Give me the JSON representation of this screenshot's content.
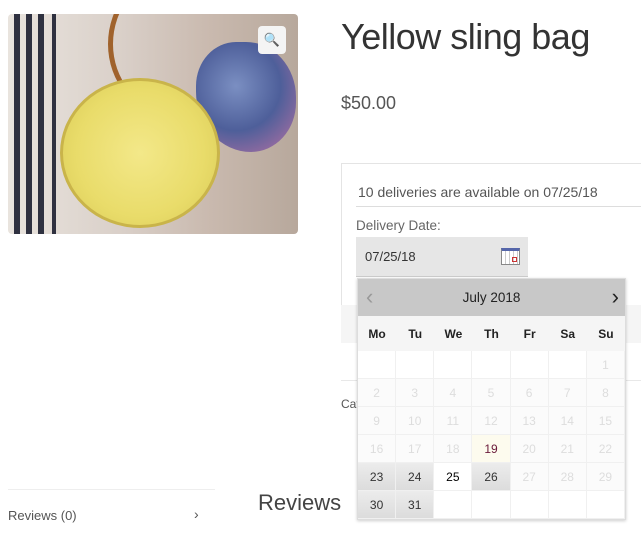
{
  "product": {
    "title": "Yellow sling bag",
    "price": "$50.00",
    "zoom_icon": "magnifier-plus-icon"
  },
  "delivery": {
    "availability": "10 deliveries are available on 07/25/18",
    "label": "Delivery Date:",
    "value": "07/25/18",
    "calendar_icon": "calendar-icon"
  },
  "meta": {
    "categories_partial": "Cat"
  },
  "calendar": {
    "month_label": "July 2018",
    "prev": "‹",
    "next": "›",
    "weekdays": [
      "Mo",
      "Tu",
      "We",
      "Th",
      "Fr",
      "Sa",
      "Su"
    ],
    "leading_blanks": 6,
    "days": [
      {
        "d": "1",
        "s": "disabled"
      },
      {
        "d": "2",
        "s": "disabled"
      },
      {
        "d": "3",
        "s": "disabled"
      },
      {
        "d": "4",
        "s": "disabled"
      },
      {
        "d": "5",
        "s": "disabled"
      },
      {
        "d": "6",
        "s": "disabled"
      },
      {
        "d": "7",
        "s": "disabled"
      },
      {
        "d": "8",
        "s": "disabled"
      },
      {
        "d": "9",
        "s": "disabled"
      },
      {
        "d": "10",
        "s": "disabled"
      },
      {
        "d": "11",
        "s": "disabled"
      },
      {
        "d": "12",
        "s": "disabled"
      },
      {
        "d": "13",
        "s": "disabled"
      },
      {
        "d": "14",
        "s": "disabled"
      },
      {
        "d": "15",
        "s": "disabled"
      },
      {
        "d": "16",
        "s": "disabled"
      },
      {
        "d": "17",
        "s": "disabled"
      },
      {
        "d": "18",
        "s": "disabled"
      },
      {
        "d": "19",
        "s": "today"
      },
      {
        "d": "20",
        "s": "disabled"
      },
      {
        "d": "21",
        "s": "disabled"
      },
      {
        "d": "22",
        "s": "disabled"
      },
      {
        "d": "23",
        "s": "available"
      },
      {
        "d": "24",
        "s": "available"
      },
      {
        "d": "25",
        "s": "selected"
      },
      {
        "d": "26",
        "s": "available"
      },
      {
        "d": "27",
        "s": "disabled"
      },
      {
        "d": "28",
        "s": "disabled"
      },
      {
        "d": "29",
        "s": "disabled"
      },
      {
        "d": "30",
        "s": "available"
      },
      {
        "d": "31",
        "s": "available"
      }
    ]
  },
  "tabs": {
    "reviews": "Reviews (0)",
    "chevron": "›"
  },
  "reviews": {
    "heading": "Reviews"
  }
}
